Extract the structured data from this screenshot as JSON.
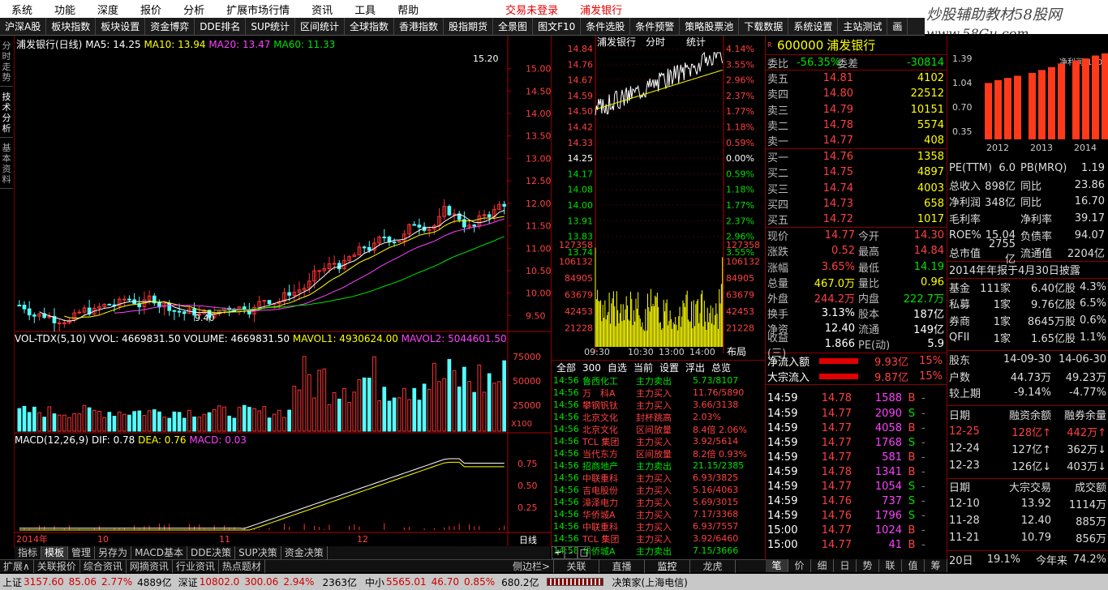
{
  "menu": {
    "items": [
      "系统",
      "功能",
      "深度",
      "报价",
      "分析",
      "扩展市场行情",
      "资讯",
      "工具",
      "帮助"
    ],
    "login": "交易未登录",
    "stock": "浦发银行"
  },
  "logo": {
    "text": "炒股辅助教材58股网",
    "url": "www.58Gu.com"
  },
  "toolbar": {
    "items": [
      "沪深A股",
      "板块指数",
      "板块设置",
      "资金博弈",
      "DDE排名",
      "SUP统计",
      "区间统计",
      "全球指数",
      "香港指数",
      "股指期货",
      "全景图",
      "图文F10",
      "条件选股",
      "条件预警",
      "策略股票池",
      "下载数据",
      "系统设置",
      "主站测试",
      "画"
    ]
  },
  "vtabs": [
    "分时走势",
    "技术分析",
    "基本资料"
  ],
  "kline": {
    "title": "浦发银行(日线)",
    "ma5": "MA5: 14.25",
    "ma10": "MA10: 13.94",
    "ma20": "MA20: 13.47",
    "ma60": "MA60: 11.33",
    "high_label": "15.20",
    "low_label": "9.40",
    "ticks": [
      "15.00",
      "14.50",
      "14.00",
      "13.50",
      "13.00",
      "12.50",
      "12.00",
      "11.50",
      "11.00",
      "10.50",
      "10.00",
      "9.50"
    ]
  },
  "vol": {
    "title": "VOL-TDX(5,10)",
    "vvol": "VVOL: 4669831.50",
    "volume": "VOLUME: 4669831.50",
    "mavol1": "MAVOL1: 4930624.00",
    "mavol2": "MAVOL2: 5044601.50",
    "ticks": [
      "75000",
      "50000",
      "25000"
    ],
    "unit": "X100"
  },
  "macd": {
    "title": "MACD(12,26,9)",
    "dif": "DIF: 0.78",
    "dea": "DEA: 0.76",
    "macd": "MACD: 0.03",
    "ticks": [
      "0.75",
      "0.50",
      "0.25"
    ],
    "months": [
      "2014年",
      "10",
      "11",
      "12"
    ],
    "period": "日线"
  },
  "bottom_tabs": [
    "指标",
    "模板",
    "管理",
    "另存为",
    "MACD基本",
    "DDE决策",
    "SUP决策",
    "资金决策"
  ],
  "bottom_tabs2": [
    "扩展∧",
    "关联报价",
    "综合资讯",
    "网摘资讯",
    "行业资讯",
    "热点题材"
  ],
  "mini": {
    "title": "浦发银行",
    "t1": "分时",
    "t2": "统计",
    "prices": [
      "14.84",
      "14.76",
      "14.67",
      "14.59",
      "14.50",
      "14.42",
      "14.33",
      "14.25",
      "14.17",
      "14.08",
      "14.00",
      "13.91",
      "13.83",
      "13.74"
    ],
    "pcts": [
      "4.14%",
      "3.55%",
      "2.96%",
      "2.37%",
      "1.77%",
      "1.18%",
      "0.59%",
      "0.00%",
      "0.59%",
      "1.18%",
      "1.77%",
      "2.37%",
      "2.96%",
      "3.55%"
    ],
    "vols": [
      "127358",
      "106132",
      "84905",
      "63679",
      "42453",
      "21228"
    ],
    "times": [
      "09:30",
      "10:30",
      "13:00",
      "14:00"
    ],
    "layout": "布局"
  },
  "ticker": {
    "tabs": [
      "全部",
      "300",
      "自选",
      "当前",
      "设置",
      "浮出",
      "总览"
    ],
    "rows": [
      [
        "14:56",
        "鲁西化工",
        "主力卖出",
        "5.73/8107"
      ],
      [
        "14:56",
        "万　科A",
        "主力买入",
        "11.76/5890"
      ],
      [
        "14:56",
        "攀钢钒钛",
        "主力买入",
        "3.66/3138"
      ],
      [
        "14:56",
        "北京文化",
        "封杯跳高",
        "2.03%"
      ],
      [
        "14:56",
        "北京文化",
        "区间放量",
        "8.4倍 2.06%"
      ],
      [
        "14:56",
        "TCL 集团",
        "主力买入",
        "3.92/5614"
      ],
      [
        "14:56",
        "当代东方",
        "区间放量",
        "8.2倍 0.93%"
      ],
      [
        "14:56",
        "招商地产",
        "主力卖出",
        "21.15/2385"
      ],
      [
        "14:56",
        "中联重科",
        "主力买入",
        "6.93/3825"
      ],
      [
        "14:56",
        "吉电股份",
        "主力买入",
        "5.16/4063"
      ],
      [
        "14:56",
        "漳泽电力",
        "主力买入",
        "5.69/3015"
      ],
      [
        "14:56",
        "华侨城A",
        "主力买入",
        "7.17/3368"
      ],
      [
        "14:56",
        "中联重科",
        "主力买入",
        "6.93/7557"
      ],
      [
        "14:56",
        "TCL 集团",
        "主力买入",
        "3.92/6460"
      ],
      [
        "14:58",
        "华侨城A",
        "主力卖出",
        "7.15/3666"
      ]
    ],
    "btns": [
      "+",
      "-",
      "□"
    ],
    "footer": [
      "侧边栏>",
      "关联",
      "直播",
      "监控",
      "龙虎"
    ]
  },
  "quote": {
    "code": "600000",
    "name": "浦发银行",
    "badge": "R",
    "wb": "委比",
    "wb_v": "-56.35%",
    "wc": "委差",
    "wc_v": "-30814",
    "sells": [
      [
        "卖五",
        "14.81",
        "4102"
      ],
      [
        "卖四",
        "14.80",
        "22512"
      ],
      [
        "卖三",
        "14.79",
        "10151"
      ],
      [
        "卖二",
        "14.78",
        "5574"
      ],
      [
        "卖一",
        "14.77",
        "408"
      ]
    ],
    "buys": [
      [
        "买一",
        "14.76",
        "1358"
      ],
      [
        "买二",
        "14.75",
        "4897"
      ],
      [
        "买三",
        "14.74",
        "4003"
      ],
      [
        "买四",
        "14.73",
        "658"
      ],
      [
        "买五",
        "14.72",
        "1017"
      ]
    ],
    "stats": [
      [
        "现价",
        "14.77",
        "今开",
        "14.30"
      ],
      [
        "涨跌",
        "0.52",
        "最高",
        "14.84"
      ],
      [
        "涨幅",
        "3.65%",
        "最低",
        "14.19"
      ],
      [
        "总量",
        "467.0万",
        "量比",
        "0.96"
      ],
      [
        "外盘",
        "244.2万",
        "内盘",
        "222.7万"
      ],
      [
        "换手",
        "3.13%",
        "股本",
        "187亿"
      ],
      [
        "净资",
        "12.40",
        "流通",
        "149亿"
      ],
      [
        "收益(三)",
        "1.866",
        "PE(动)",
        "5.9"
      ]
    ],
    "flow": [
      [
        "净流入额",
        "9.93亿",
        "15%"
      ],
      [
        "大宗流入",
        "9.87亿",
        "15%"
      ]
    ],
    "deals": [
      [
        "14:59",
        "14.78",
        "1588",
        "B"
      ],
      [
        "14:59",
        "14.77",
        "2090",
        "S"
      ],
      [
        "14:59",
        "14.77",
        "4058",
        "B"
      ],
      [
        "14:59",
        "14.77",
        "1768",
        "S"
      ],
      [
        "14:59",
        "14.77",
        "581",
        "B"
      ],
      [
        "14:59",
        "14.78",
        "1341",
        "B"
      ],
      [
        "14:59",
        "14.77",
        "1054",
        "S"
      ],
      [
        "14:59",
        "14.76",
        "737",
        "S"
      ],
      [
        "14:59",
        "14.76",
        "1796",
        "S"
      ],
      [
        "15:00",
        "14.77",
        "1024",
        "B"
      ],
      [
        "15:00",
        "14.77",
        "41",
        "B"
      ]
    ],
    "foot": [
      "笔",
      "价",
      "细",
      "日",
      "势",
      "联",
      "值",
      "筹"
    ]
  },
  "fund": {
    "bar_label": "净利润(100亿)",
    "bar_yticks": [
      "1.39",
      "1.04",
      "0.70",
      "0.35"
    ],
    "bar_years": [
      "2012",
      "2013",
      "2014"
    ],
    "rows": [
      [
        "PE(TTM)",
        "6.0",
        "PB(MRQ)",
        "1.19"
      ],
      [
        "总收入",
        "898亿",
        "同比",
        "23.86"
      ],
      [
        "净利润",
        "348亿",
        "同比",
        "16.70"
      ],
      [
        "毛利率",
        "",
        "净利率",
        "39.17"
      ],
      [
        "ROE%",
        "15.04",
        "负债率",
        "94.07"
      ],
      [
        "总市值",
        "2755亿",
        "流通值",
        "2204亿"
      ]
    ],
    "report": "2014年年报于4月30日披露",
    "holders": [
      [
        "基金",
        "111家",
        "6.40亿股",
        "4.3%"
      ],
      [
        "私募",
        "1家",
        "9.76亿股",
        "6.5%"
      ],
      [
        "券商",
        "1家",
        "8645万股",
        "0.6%"
      ],
      [
        "QFII",
        "1家",
        "1.65亿股",
        "1.1%"
      ]
    ],
    "dates": [
      [
        "股东",
        "14-09-30",
        "14-06-30"
      ],
      [
        "户数",
        "44.73万",
        "49.23万"
      ],
      [
        "较上期",
        "-9.14%",
        "-4.77%"
      ]
    ],
    "margin_hdr": [
      "日期",
      "融资余额",
      "融券余量"
    ],
    "margin": [
      [
        "12-25",
        "128亿↑",
        "442万↑"
      ],
      [
        "12-24",
        "127亿↑",
        "362万↓"
      ],
      [
        "12-23",
        "126亿↓",
        "403万↓"
      ]
    ],
    "block_hdr": [
      "日期",
      "大宗交易",
      "成交额"
    ],
    "block": [
      [
        "12-10",
        "13.92",
        "1114万"
      ],
      [
        "11-28",
        "12.40",
        "885万"
      ],
      [
        "11-21",
        "10.79",
        "856万"
      ]
    ],
    "last": [
      "20日",
      "19.1%",
      "今年来",
      "74.2%"
    ]
  },
  "status": {
    "sh_lbl": "上证",
    "sh": "3157.60",
    "sh_ch": "85.06",
    "sh_pct": "2.77%",
    "sh_amt": "4889亿",
    "sz_lbl": "深证",
    "sz": "10802.0",
    "sz_ch": "300.06",
    "sz_pct": "2.94%",
    "sz_amt": "2363亿",
    "zx_lbl": "中小",
    "zx": "5565.01",
    "zx_ch": "46.70",
    "zx_pct": "0.85%",
    "zx_amt": "680.2亿",
    "src": "决策家(上海电信)"
  }
}
